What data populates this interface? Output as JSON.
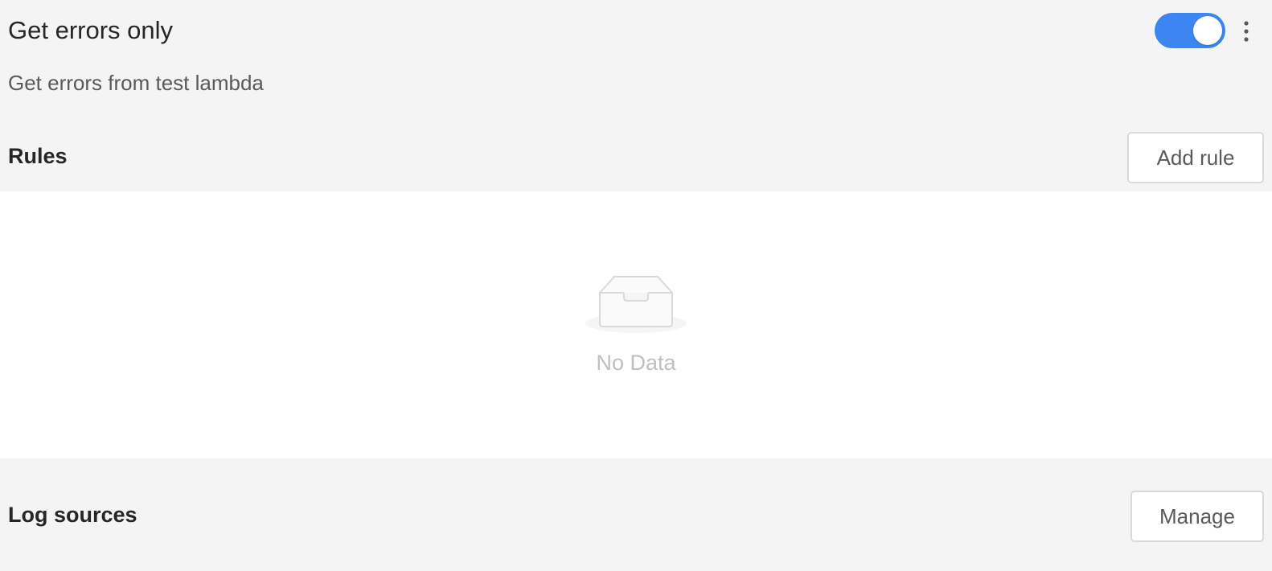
{
  "header": {
    "title": "Get errors only",
    "description": "Get errors from test lambda",
    "toggle_state": "on",
    "toggle_color": "#3b86f0"
  },
  "rules": {
    "title": "Rules",
    "add_button_label": "Add rule",
    "empty_text": "No Data",
    "empty_icon": "empty-inbox-icon"
  },
  "log_sources": {
    "title": "Log sources",
    "manage_button_label": "Manage"
  }
}
